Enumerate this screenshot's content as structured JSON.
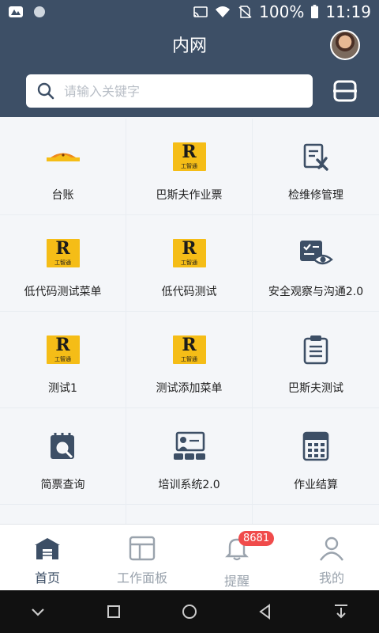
{
  "status": {
    "battery": "100%",
    "time": "11:19"
  },
  "header": {
    "title": "内网"
  },
  "search": {
    "placeholder": "请输入关键字"
  },
  "grid": [
    {
      "label": "台账",
      "icon": "ledger-icon"
    },
    {
      "label": "巴斯夫作业票",
      "icon": "gongzhitong-logo-icon"
    },
    {
      "label": "检维修管理",
      "icon": "maintenance-icon"
    },
    {
      "label": "低代码测试菜单",
      "icon": "gongzhitong-logo-icon"
    },
    {
      "label": "低代码测试",
      "icon": "gongzhitong-logo-icon"
    },
    {
      "label": "安全观察与沟通2.0",
      "icon": "safety-observation-icon"
    },
    {
      "label": "测试1",
      "icon": "gongzhitong-logo-icon"
    },
    {
      "label": "测试添加菜单",
      "icon": "gongzhitong-logo-icon"
    },
    {
      "label": "巴斯夫测试",
      "icon": "clipboard-icon"
    },
    {
      "label": "简票查询",
      "icon": "ticket-search-icon"
    },
    {
      "label": "培训系统2.0",
      "icon": "training-icon"
    },
    {
      "label": "作业结算",
      "icon": "calculator-icon"
    },
    {
      "label": "",
      "icon": ""
    },
    {
      "label": "",
      "icon": ""
    },
    {
      "label": "",
      "icon": ""
    }
  ],
  "logo": {
    "letter": "R",
    "text": "工智通"
  },
  "tabs": [
    {
      "label": "首页",
      "icon": "home-icon",
      "active": true
    },
    {
      "label": "工作面板",
      "icon": "dashboard-icon",
      "active": false
    },
    {
      "label": "提醒",
      "icon": "bell-icon",
      "active": false,
      "badge": "8681"
    },
    {
      "label": "我的",
      "icon": "user-icon",
      "active": false
    }
  ],
  "colors": {
    "header": "#3d4f66",
    "accent_yellow": "#f5bd17",
    "badge": "#f04b4b"
  }
}
